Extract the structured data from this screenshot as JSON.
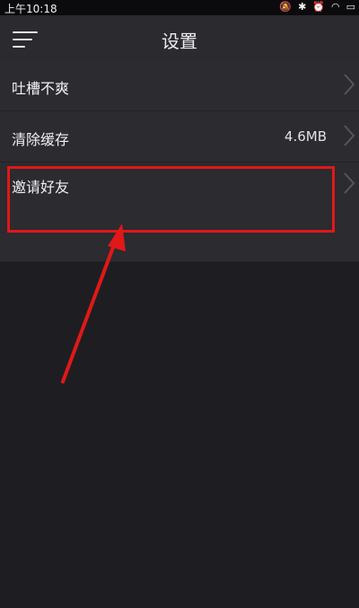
{
  "status_bar": {
    "time": "上午10:18",
    "icons": [
      "silent-icon",
      "bluetooth-icon",
      "alarm-icon",
      "wifi-icon",
      "battery-icon"
    ]
  },
  "header": {
    "title": "设置",
    "menu_icon": "menu-icon"
  },
  "settings": {
    "items": [
      {
        "label": "吐槽不爽",
        "value": ""
      },
      {
        "label": "清除缓存",
        "value": "4.6MB"
      },
      {
        "label": "邀请好友",
        "value": ""
      }
    ]
  },
  "colors": {
    "background": "#1e1e22",
    "row": "#2b2b30",
    "nav": "#2a2a2f",
    "highlight": "#e01818"
  }
}
